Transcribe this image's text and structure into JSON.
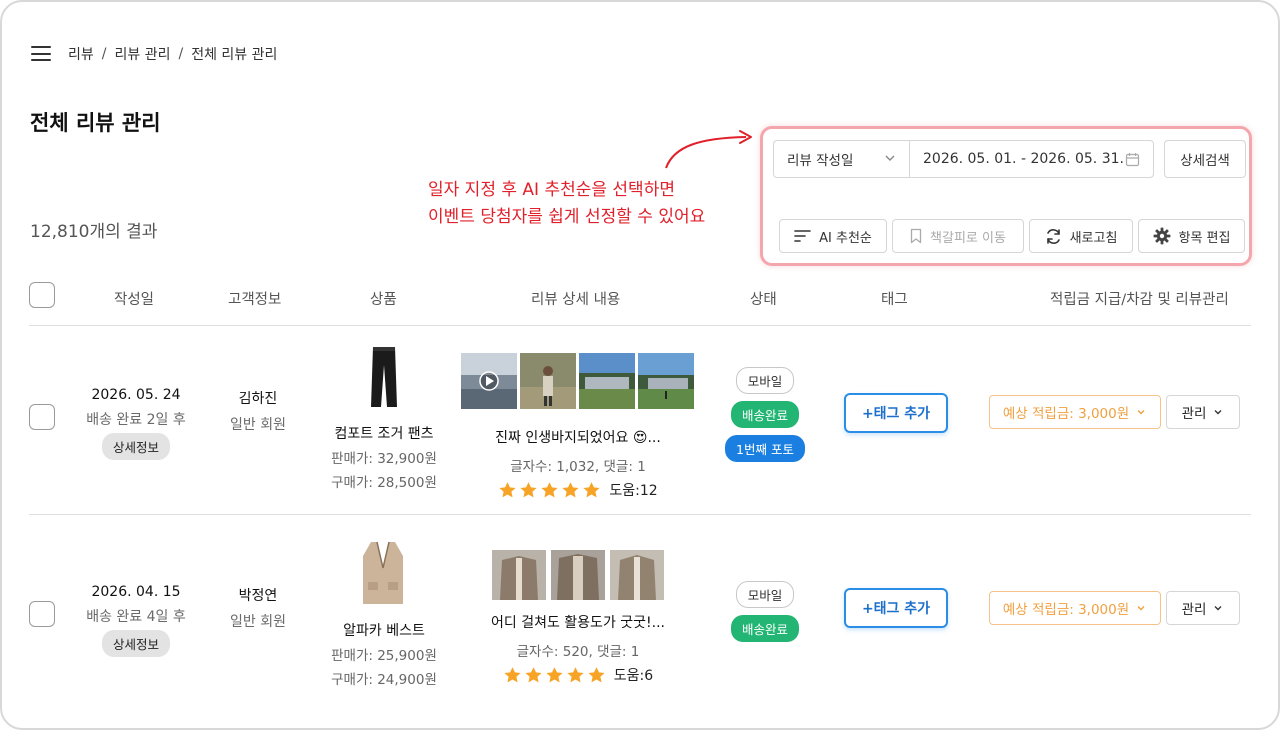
{
  "breadcrumb": {
    "items": [
      "리뷰",
      "리뷰 관리",
      "전체 리뷰 관리"
    ],
    "separator": "/"
  },
  "page": {
    "title": "전체 리뷰 관리",
    "result_count": "12,810개의 결과"
  },
  "annotation": {
    "line1": "일자 지정 후 AI 추천순을 선택하면",
    "line2": "이벤트 당첨자를 쉽게 선정할 수 있어요",
    "color": "#e0202a"
  },
  "toolbar": {
    "sort_select": "리뷰 작성일",
    "date_range": "2026. 05. 01. - 2026. 05. 31.",
    "detail_search": "상세검색",
    "ai_sort": "AI 추천순",
    "bookmark": "책갈피로 이동",
    "refresh": "새로고침",
    "edit_columns": "항목 편집"
  },
  "table": {
    "headers": [
      "작성일",
      "고객정보",
      "상품",
      "리뷰 상세 내용",
      "상태",
      "태그",
      "적립금 지급/차감 및 리뷰관리"
    ],
    "rows": [
      {
        "date": "2026. 05. 24",
        "delivery": "배송 완료 2일 후",
        "detail": "상세정보",
        "customer": "김하진",
        "grade": "일반 회원",
        "product": "컴포트 조거 팬츠",
        "sale_price": "판매가: 32,900원",
        "buy_price": "구매가: 28,500원",
        "review": "진짜 인생바지되었어요 😍...",
        "meta": "글자수: 1,032, 댓글: 1",
        "rating": 5,
        "helpful": "도움:12",
        "badges": [
          "모바일",
          "배송완료",
          "1번째 포토"
        ],
        "tag_button": "+태그 추가",
        "points": "예상 적립금: 3,000원",
        "manage": "관리"
      },
      {
        "date": "2026. 04. 15",
        "delivery": "배송 완료 4일 후",
        "detail": "상세정보",
        "customer": "박정연",
        "grade": "일반 회원",
        "product": "알파카 베스트",
        "sale_price": "판매가: 25,900원",
        "buy_price": "구매가: 24,900원",
        "review": "어디 걸쳐도 활용도가 굿굿!...",
        "meta": "글자수: 520, 댓글: 1",
        "rating": 5,
        "helpful": "도움:6",
        "badges": [
          "모바일",
          "배송완료"
        ],
        "tag_button": "+태그 추가",
        "points": "예상 적립금: 3,000원",
        "manage": "관리"
      }
    ]
  },
  "colors": {
    "accent_blue": "#2b8ee6",
    "green": "#22b573",
    "orange": "#f0a040",
    "highlight_border": "#f3a7ad",
    "star": "#f7a325"
  }
}
